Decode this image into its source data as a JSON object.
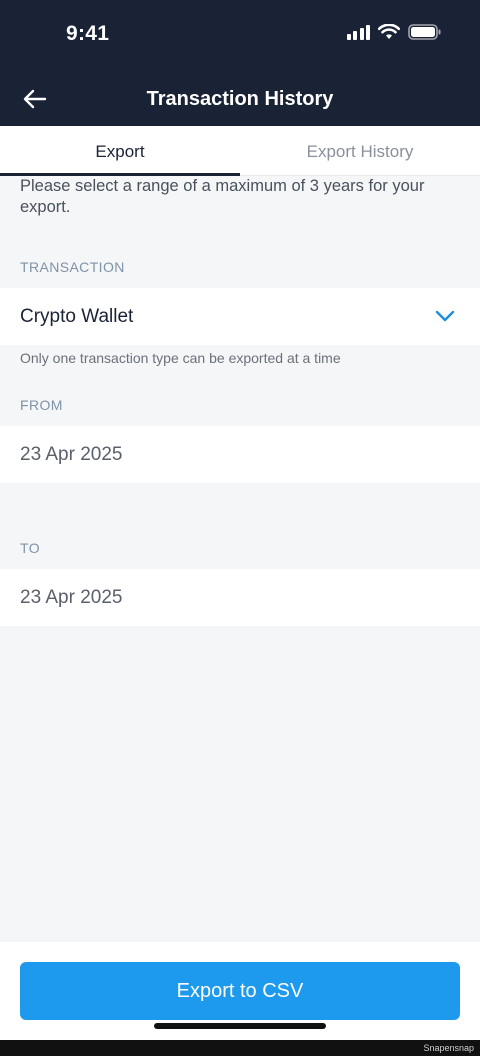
{
  "status_bar": {
    "time": "9:41",
    "icons": [
      "cellular-signal-icon",
      "wifi-icon",
      "battery-icon"
    ]
  },
  "header": {
    "title": "Transaction History",
    "back_icon": "arrow-left-icon"
  },
  "tabs": [
    {
      "label": "Export",
      "active": true
    },
    {
      "label": "Export History",
      "active": false
    }
  ],
  "info": "Please select a range of a maximum of 3 years for your export.",
  "transaction": {
    "label": "TRANSACTION",
    "value": "Crypto Wallet",
    "helper": "Only one transaction type can be exported at a time",
    "dropdown_icon": "chevron-down-icon"
  },
  "from": {
    "label": "FROM",
    "value": "23 Apr 2025"
  },
  "to": {
    "label": "TO",
    "value": "23 Apr 2025"
  },
  "actions": {
    "export_label": "Export to CSV"
  },
  "watermark": "Snapensnap",
  "colors": {
    "header_bg": "#1a2236",
    "accent": "#1d99ee",
    "chevron": "#1d8fd8"
  }
}
